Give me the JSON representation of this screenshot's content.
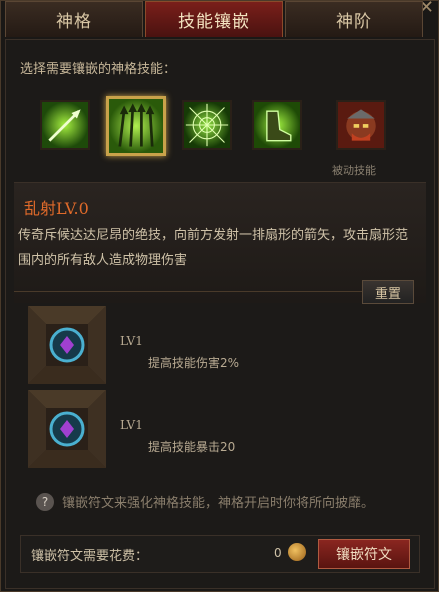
{
  "tabs": [
    {
      "label": "神格"
    },
    {
      "label": "技能镶嵌"
    },
    {
      "label": "神阶"
    }
  ],
  "close_icon": "close-icon",
  "prompt": "选择需要镶嵌的神格技能：",
  "skills": [
    {
      "icon": "arrow-icon",
      "selected": false
    },
    {
      "icon": "multi-arrow-icon",
      "selected": true
    },
    {
      "icon": "web-icon",
      "selected": false
    },
    {
      "icon": "boot-icon",
      "selected": false
    },
    {
      "icon": "warrior-icon",
      "selected": false
    }
  ],
  "passive_label": "被动技能",
  "selected_skill": {
    "name": "乱射LV.0",
    "description": "传奇斥候达达尼昂的绝技，向前方发射一排扇形的箭矢，攻击扇形范围内的所有敌人造成物理伤害"
  },
  "reset_label": "重置",
  "runes": [
    {
      "level": "LV1",
      "bonus": "提高技能伤害2%"
    },
    {
      "level": "LV1",
      "bonus": "提高技能暴击20"
    }
  ],
  "hint": "镶嵌符文来强化神格技能，神格开启时你将所向披靡。",
  "hint_icon": "?",
  "cost_label": "镶嵌符文需要花费：",
  "cost_value": "0",
  "embed_label": "镶嵌符文",
  "colors": {
    "accent": "#c9a24a",
    "title": "#e06a2a",
    "active_tab": "#7a1f1a"
  }
}
